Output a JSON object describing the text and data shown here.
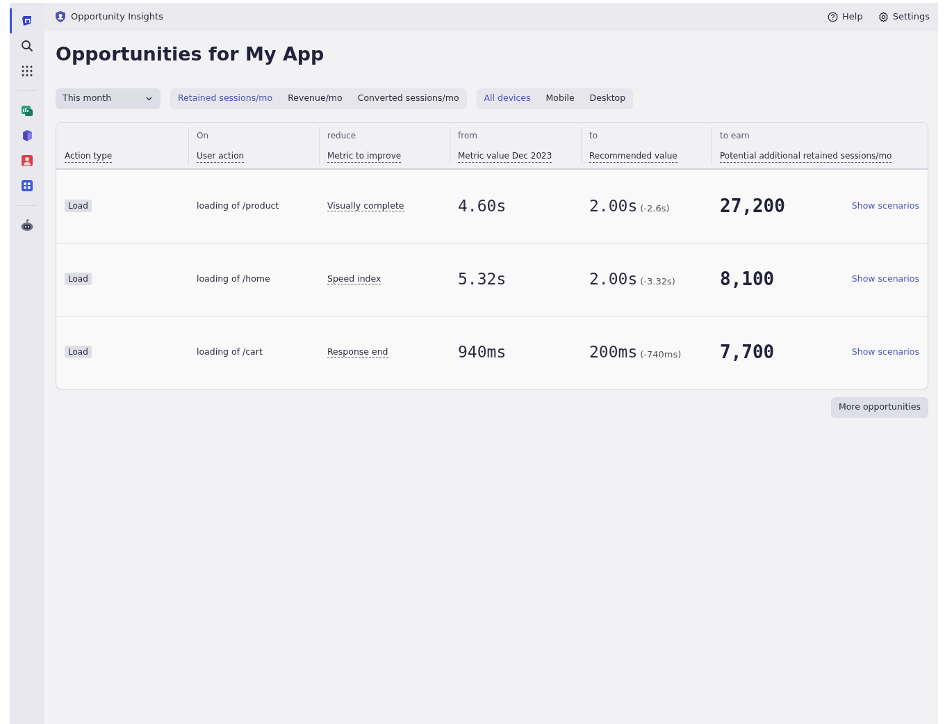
{
  "sidebar": {
    "items": [
      {
        "kind": "logo",
        "selected": true
      },
      {
        "kind": "search",
        "selected": false
      },
      {
        "kind": "apps",
        "selected": false
      },
      {
        "kind": "divider"
      },
      {
        "kind": "chart-app",
        "selected": false
      },
      {
        "kind": "cube-app",
        "selected": false
      },
      {
        "kind": "person-app",
        "selected": false
      },
      {
        "kind": "grid-app",
        "selected": false
      },
      {
        "kind": "divider"
      },
      {
        "kind": "robot",
        "selected": false
      }
    ]
  },
  "topbar": {
    "app_title": "Opportunity Insights",
    "links": [
      {
        "kind": "help",
        "label": "Help"
      },
      {
        "kind": "settings",
        "label": "Settings"
      }
    ]
  },
  "page_title": "Opportunities for My App",
  "filters": {
    "period": "This month",
    "metrics": [
      {
        "label": "Retained sessions/mo",
        "selected": true
      },
      {
        "label": "Revenue/mo",
        "selected": false
      },
      {
        "label": "Converted sessions/mo",
        "selected": false
      }
    ],
    "devices": [
      {
        "label": "All devices",
        "selected": true
      },
      {
        "label": "Mobile",
        "selected": false
      },
      {
        "label": "Desktop",
        "selected": false
      }
    ]
  },
  "table": {
    "columns": [
      {
        "label": "Action type"
      },
      {
        "over": "On",
        "label": "User action"
      },
      {
        "over": "reduce",
        "label": "Metric to improve"
      },
      {
        "over": "from",
        "label": "Metric value Dec 2023"
      },
      {
        "over": "to",
        "label": "Recommended value"
      },
      {
        "over": "to earn",
        "label": "Potential additional retained sessions/mo"
      }
    ],
    "rows": [
      {
        "action_type": "Load",
        "user_action": "loading of /product",
        "metric": "Visually complete",
        "from": "4.60s",
        "to": "2.00s",
        "delta": "(-2.6s)",
        "earn": "27,200",
        "link": "Show scenarios"
      },
      {
        "action_type": "Load",
        "user_action": "loading of /home",
        "metric": "Speed index",
        "from": "5.32s",
        "to": "2.00s",
        "delta": "(-3.32s)",
        "earn": "8,100",
        "link": "Show scenarios"
      },
      {
        "action_type": "Load",
        "user_action": "loading of /cart",
        "metric": "Response end",
        "from": "940ms",
        "to": "200ms",
        "delta": "(-740ms)",
        "earn": "7,700",
        "link": "Show scenarios"
      }
    ]
  },
  "more_button": "More opportunities"
}
